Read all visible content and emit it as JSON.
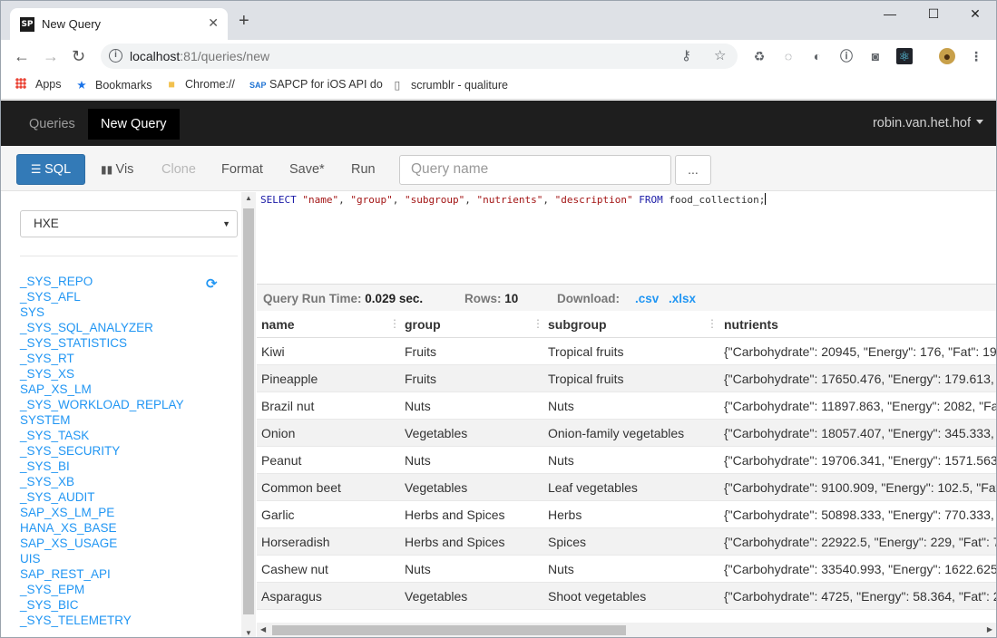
{
  "browser": {
    "tab_title": "New Query",
    "tab_favicon": "SP",
    "url_host": "localhost",
    "url_rest": ":81/queries/new",
    "bookmarks": [
      {
        "label": "Apps",
        "icon": "apps-icon"
      },
      {
        "label": "Bookmarks",
        "icon": "star-icon"
      },
      {
        "label": "Chrome://",
        "icon": "folder-icon"
      },
      {
        "label": "SAPCP for iOS API do",
        "icon": "sap-icon"
      },
      {
        "label": "scrumblr - qualiture",
        "icon": "page-icon"
      }
    ]
  },
  "appnav": {
    "items": [
      "Queries",
      "New Query"
    ],
    "active": "New Query",
    "user": "robin.van.het.hof"
  },
  "toolbar": {
    "sql_label": "SQL",
    "vis_label": "Vis",
    "clone_label": "Clone",
    "format_label": "Format",
    "save_label": "Save*",
    "run_label": "Run",
    "query_name_placeholder": "Query name",
    "more_label": "..."
  },
  "sidebar": {
    "database": "HXE",
    "schemas": [
      "_SYS_REPO",
      "_SYS_AFL",
      "SYS",
      "_SYS_SQL_ANALYZER",
      "_SYS_STATISTICS",
      "_SYS_RT",
      "_SYS_XS",
      "SAP_XS_LM",
      "_SYS_WORKLOAD_REPLAY",
      "SYSTEM",
      "_SYS_TASK",
      "_SYS_SECURITY",
      "_SYS_BI",
      "_SYS_XB",
      "_SYS_AUDIT",
      "SAP_XS_LM_PE",
      "HANA_XS_BASE",
      "SAP_XS_USAGE",
      "UIS",
      "SAP_REST_API",
      "_SYS_EPM",
      "_SYS_BIC",
      "_SYS_TELEMETRY"
    ]
  },
  "editor": {
    "kw_select": "SELECT",
    "cols": [
      "\"name\"",
      "\"group\"",
      "\"subgroup\"",
      "\"nutrients\"",
      "\"description\""
    ],
    "kw_from": "FROM",
    "table": "food_collection;"
  },
  "run_info": {
    "time_label": "Query Run Time:",
    "time_value": "0.029 sec.",
    "rows_label": "Rows:",
    "rows_value": "10",
    "download_label": "Download:",
    "csv": ".csv",
    "xlsx": ".xlsx"
  },
  "results": {
    "columns": [
      "name",
      "group",
      "subgroup",
      "nutrients"
    ],
    "rows": [
      [
        "Kiwi",
        "Fruits",
        "Tropical fruits",
        "{\"Carbohydrate\": 20945, \"Energy\": 176, \"Fat\": 19"
      ],
      [
        "Pineapple",
        "Fruits",
        "Tropical fruits",
        "{\"Carbohydrate\": 17650.476, \"Energy\": 179.613, "
      ],
      [
        "Brazil nut",
        "Nuts",
        "Nuts",
        "{\"Carbohydrate\": 11897.863, \"Energy\": 2082, \"Fa"
      ],
      [
        "Onion",
        "Vegetables",
        "Onion-family vegetables",
        "{\"Carbohydrate\": 18057.407, \"Energy\": 345.333, "
      ],
      [
        "Peanut",
        "Nuts",
        "Nuts",
        "{\"Carbohydrate\": 19706.341, \"Energy\": 1571.563"
      ],
      [
        "Common beet",
        "Vegetables",
        "Leaf vegetables",
        "{\"Carbohydrate\": 9100.909, \"Energy\": 102.5, \"Fat"
      ],
      [
        "Garlic",
        "Herbs and Spices",
        "Herbs",
        "{\"Carbohydrate\": 50898.333, \"Energy\": 770.333, "
      ],
      [
        "Horseradish",
        "Herbs and Spices",
        "Spices",
        "{\"Carbohydrate\": 22922.5, \"Energy\": 229, \"Fat\": 7"
      ],
      [
        "Cashew nut",
        "Nuts",
        "Nuts",
        "{\"Carbohydrate\": 33540.993, \"Energy\": 1622.625"
      ],
      [
        "Asparagus",
        "Vegetables",
        "Shoot vegetables",
        "{\"Carbohydrate\": 4725, \"Energy\": 58.364, \"Fat\": 2"
      ]
    ]
  },
  "colors": {
    "primary": "#337ab7",
    "link": "#2196f3",
    "nav_bg": "#1e1e1e"
  }
}
